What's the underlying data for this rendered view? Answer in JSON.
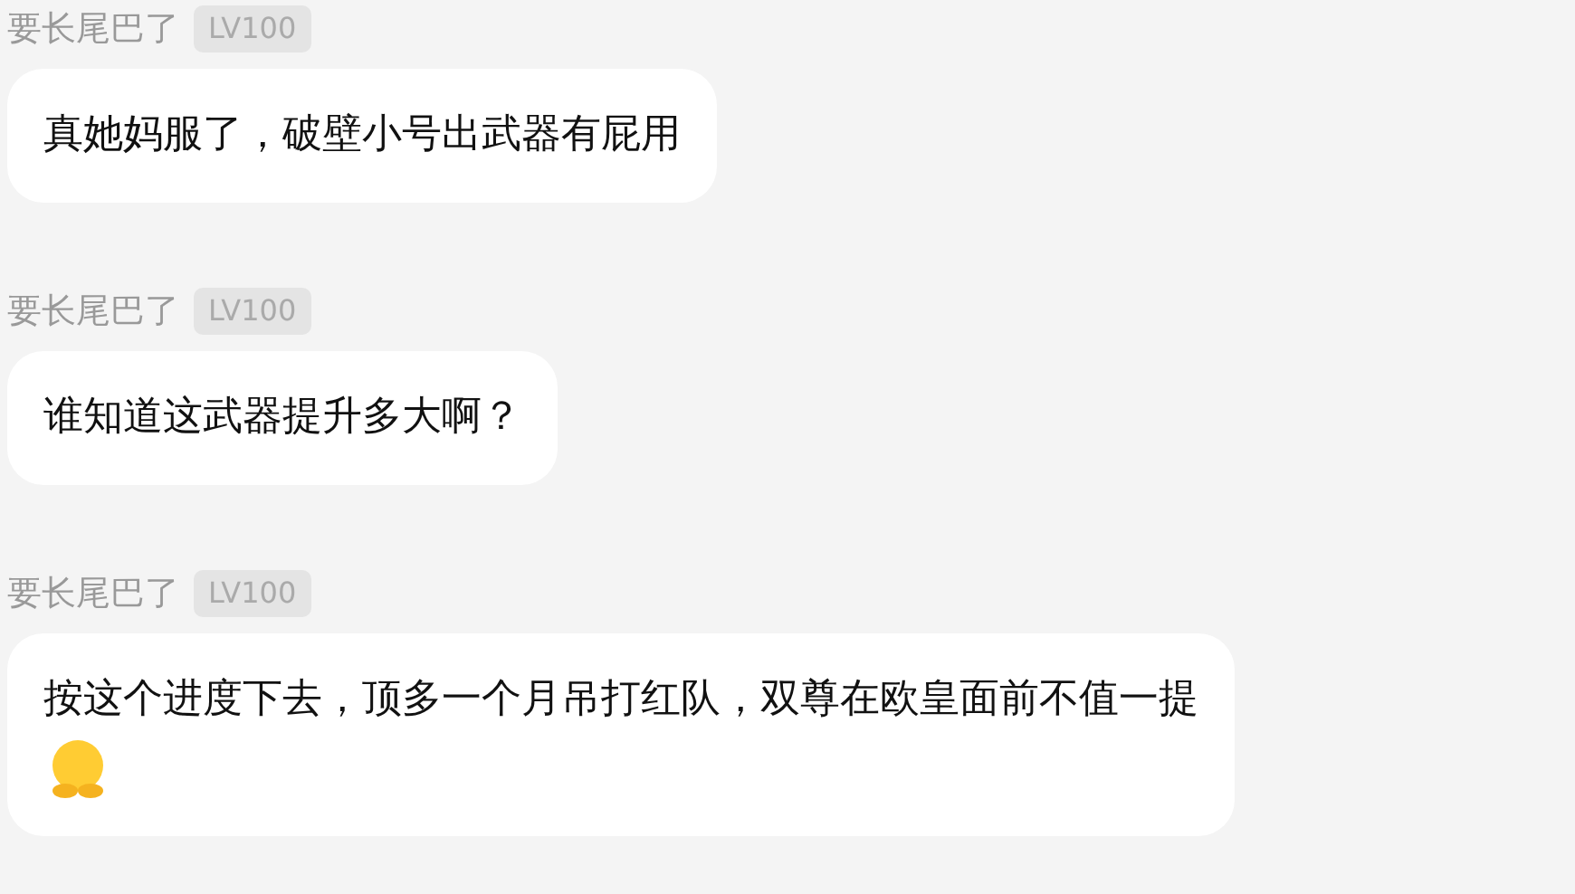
{
  "messages": [
    {
      "author": "要长尾巴了",
      "badge": "LV100",
      "text": "真她妈服了，破壁小号出武器有屁用",
      "emoji": false
    },
    {
      "author": "要长尾巴了",
      "badge": "LV100",
      "text": "谁知道这武器提升多大啊？",
      "emoji": false
    },
    {
      "author": "要长尾巴了",
      "badge": "LV100",
      "text": "按这个进度下去，顶多一个月吊打红队，双尊在欧皇面前不值一提",
      "emoji": true
    }
  ]
}
